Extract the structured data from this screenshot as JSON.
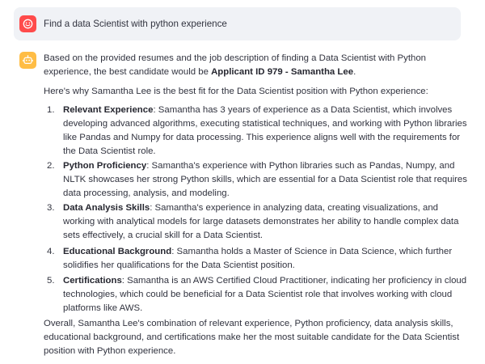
{
  "user_message": {
    "avatar_icon": "smiley-face-icon",
    "avatar_color": "#ff4b4b",
    "text": "Find a data Scientist with python experience"
  },
  "assistant_message": {
    "avatar_icon": "robot-icon",
    "avatar_color": "#ffbd45",
    "intro": {
      "before": "Based on the provided resumes and the job description of finding a Data Scientist with Python experience, the best candidate would be ",
      "bold": "Applicant ID 979 - Samantha Lee",
      "after": "."
    },
    "why": "Here's why Samantha Lee is the best fit for the Data Scientist position with Python experience:",
    "items": [
      {
        "number": "1.",
        "title": "Relevant Experience",
        "text": ": Samantha has 3 years of experience as a Data Scientist, which involves developing advanced algorithms, executing statistical techniques, and working with Python libraries like Pandas and Numpy for data processing. This experience aligns well with the requirements for the Data Scientist role."
      },
      {
        "number": "2.",
        "title": "Python Proficiency",
        "text": ": Samantha's experience with Python libraries such as Pandas, Numpy, and NLTK showcases her strong Python skills, which are essential for a Data Scientist role that requires data processing, analysis, and modeling."
      },
      {
        "number": "3.",
        "title": "Data Analysis Skills",
        "text": ": Samantha's experience in analyzing data, creating visualizations, and working with analytical models for large datasets demonstrates her ability to handle complex data sets effectively, a crucial skill for a Data Scientist."
      },
      {
        "number": "4.",
        "title": "Educational Background",
        "text": ": Samantha holds a Master of Science in Data Science, which further solidifies her qualifications for the Data Scientist position."
      },
      {
        "number": "5.",
        "title": "Certifications",
        "text": ": Samantha is an AWS Certified Cloud Practitioner, indicating her proficiency in cloud technologies, which could be beneficial for a Data Scientist role that involves working with cloud platforms like AWS."
      }
    ],
    "overall": "Overall, Samantha Lee's combination of relevant experience, Python proficiency, data analysis skills, educational background, and certifications make her the most suitable candidate for the Data Scientist position with Python experience."
  }
}
